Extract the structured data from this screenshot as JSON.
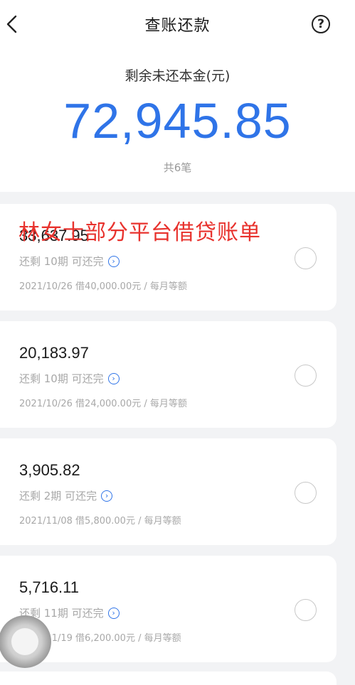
{
  "header": {
    "back_icon": "chevron-left-icon",
    "title": "查账还款",
    "help_label": "?"
  },
  "summary": {
    "label": "剩余未还本金(元)",
    "amount": "72,945.85",
    "count": "共6笔"
  },
  "watermark": "林女士部分平台借贷账单",
  "loans": [
    {
      "amount": "33,637.95",
      "status": "还剩 10期 可还完",
      "detail": "2021/10/26 借40,000.00元 / 每月等额"
    },
    {
      "amount": "20,183.97",
      "status": "还剩 10期 可还完",
      "detail": "2021/10/26 借24,000.00元 / 每月等额"
    },
    {
      "amount": "3,905.82",
      "status": "还剩 2期 可还完",
      "detail": "2021/11/08 借5,800.00元 / 每月等额"
    },
    {
      "amount": "5,716.11",
      "status": "还剩 11期 可还完",
      "detail": "2021/11/19 借6,200.00元 / 每月等额"
    }
  ],
  "colors": {
    "accent": "#2f74e8",
    "watermark": "#e8322d"
  }
}
